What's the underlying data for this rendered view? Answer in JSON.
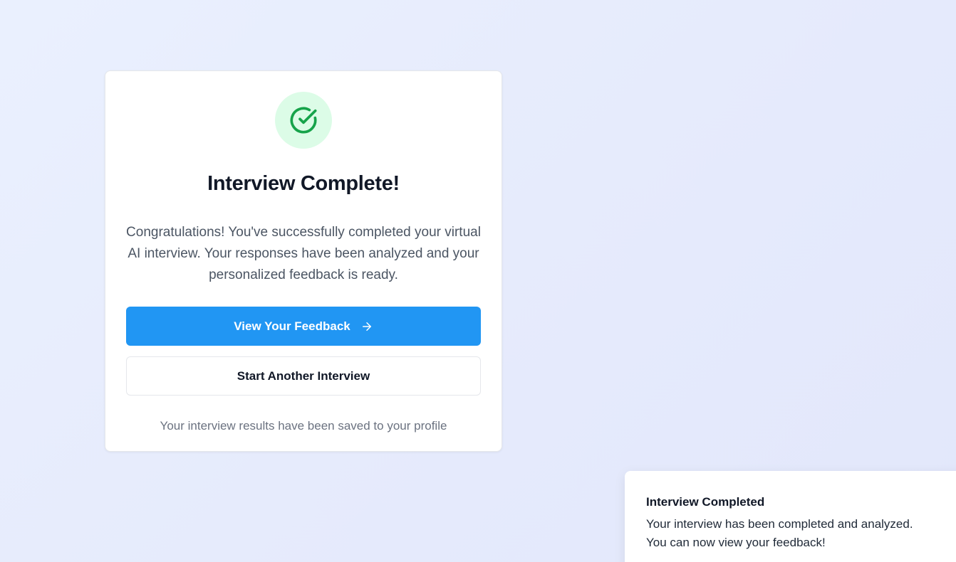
{
  "card": {
    "icon": "check-circle-icon",
    "title": "Interview Complete!",
    "message": "Congratulations! You've successfully completed your virtual AI interview. Your responses have been analyzed and your personalized feedback is ready.",
    "primary_button": {
      "label": "View Your Feedback",
      "icon": "arrow-right-icon"
    },
    "secondary_button": {
      "label": "Start Another Interview"
    },
    "footer_note": "Your interview results have been saved to your profile"
  },
  "toast": {
    "title": "Interview Completed",
    "message": "Your interview has been completed and analyzed. You can now view your feedback!"
  },
  "colors": {
    "accent": "#2196f3",
    "success": "#16a34a",
    "success_bg": "#dcfce7"
  }
}
